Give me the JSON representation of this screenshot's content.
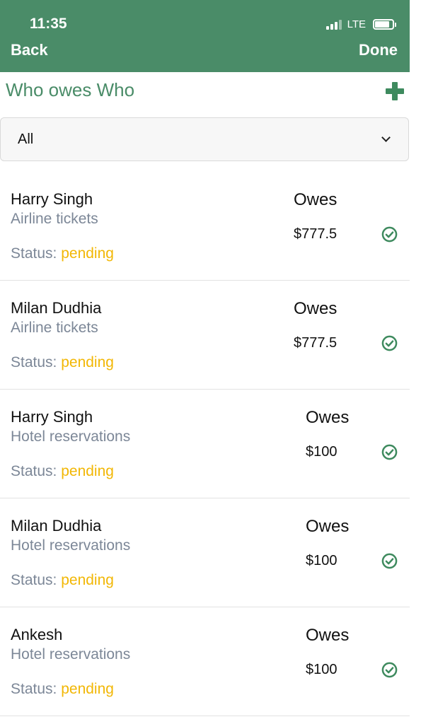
{
  "status_bar": {
    "time": "11:35",
    "network": "LTE"
  },
  "nav": {
    "back_label": "Back",
    "done_label": "Done"
  },
  "page": {
    "title": "Who owes Who",
    "add_icon": "plus-icon"
  },
  "filter": {
    "selected": "All"
  },
  "colors": {
    "brand": "#4a8c68",
    "pending": "#f2b705",
    "secondary_text": "#7c8797"
  },
  "items": [
    {
      "name": "Harry Singh",
      "description": "Airline tickets",
      "status_label": "Status:",
      "status": "pending",
      "owes_label": "Owes",
      "amount": "$777.5",
      "icon": "check-circle-icon"
    },
    {
      "name": "Milan Dudhia",
      "description": "Airline tickets",
      "status_label": "Status:",
      "status": "pending",
      "owes_label": "Owes",
      "amount": "$777.5",
      "icon": "check-circle-icon"
    },
    {
      "name": "Harry Singh",
      "description": "Hotel reservations",
      "status_label": "Status:",
      "status": "pending",
      "owes_label": "Owes",
      "amount": "$100",
      "icon": "check-circle-icon"
    },
    {
      "name": "Milan Dudhia",
      "description": "Hotel reservations",
      "status_label": "Status:",
      "status": "pending",
      "owes_label": "Owes",
      "amount": "$100",
      "icon": "check-circle-icon"
    },
    {
      "name": "Ankesh",
      "description": "Hotel reservations",
      "status_label": "Status:",
      "status": "pending",
      "owes_label": "Owes",
      "amount": "$100",
      "icon": "check-circle-icon"
    }
  ]
}
